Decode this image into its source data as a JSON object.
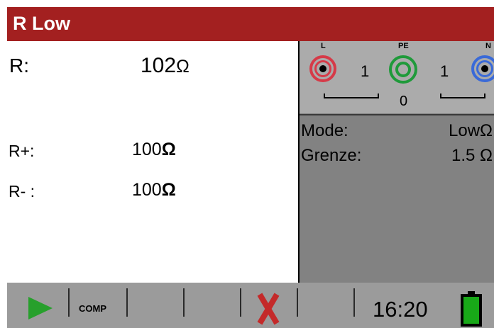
{
  "window": {
    "title": "R Low"
  },
  "measurement": {
    "r_label": "R:",
    "r_value": "102",
    "rplus_label": "R+:",
    "rplus_value": "100",
    "rminus_label": "R- :",
    "rminus_value": "100",
    "unit": "Ω"
  },
  "terminals": {
    "l_label": "L",
    "pe_label": "PE",
    "n_label": "N",
    "l_pe_value": "1",
    "pe_n_value": "1",
    "below_value": "0"
  },
  "settings": {
    "mode_label": "Mode:",
    "mode_value": "LowΩ",
    "limit_label": "Grenze:",
    "limit_value": "1.5 Ω"
  },
  "toolbar": {
    "start_icon": "play-icon",
    "comp_label": "COMP",
    "cancel_icon": "x-icon",
    "time": "16:20",
    "battery_icon": "battery-icon"
  },
  "colors": {
    "title_bar": "#a32020",
    "l_terminal": "#d63a48",
    "pe_terminal": "#1f9a3a",
    "n_terminal": "#3a6ad8",
    "start_icon": "#27a02c",
    "cancel_icon": "#c42a2a",
    "battery": "#18a818"
  }
}
